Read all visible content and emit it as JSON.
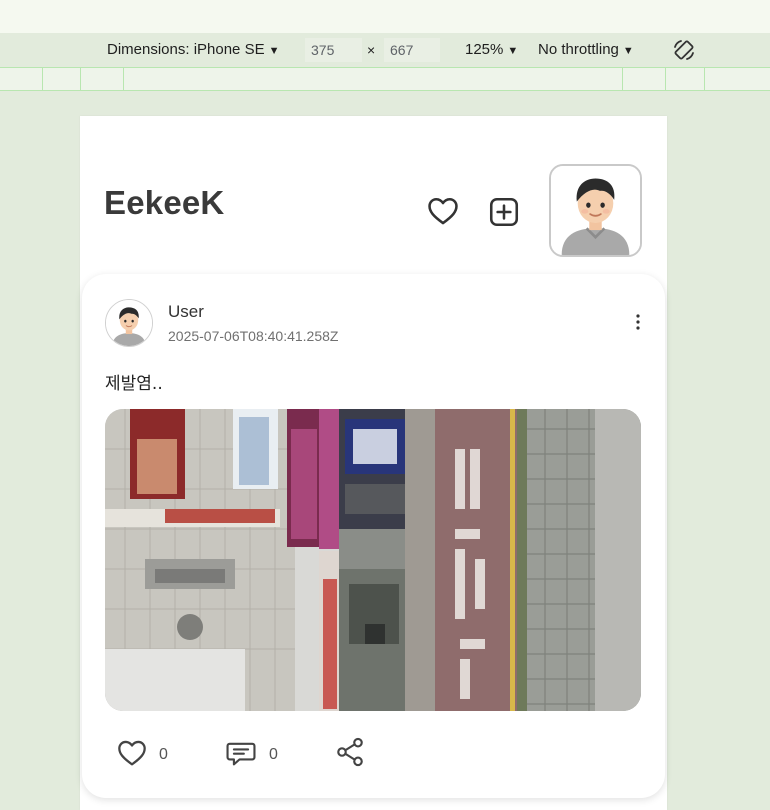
{
  "devtools": {
    "dimensions_label": "Dimensions: iPhone SE",
    "width_value": "375",
    "times_sign": "×",
    "height_value": "667",
    "zoom": "125%",
    "throttling": "No throttling",
    "icons": {
      "caret": "caret-down-icon",
      "rotate": "rotate-device-icon"
    }
  },
  "app": {
    "title": "EekeeK",
    "header_icons": [
      "heart-icon",
      "add-square-icon",
      "profile-avatar"
    ]
  },
  "post": {
    "username": "User",
    "timestamp": "2025-07-06T08:40:41.258Z",
    "text": "제발염..",
    "likes": "0",
    "comments": "0",
    "icons": [
      "more-vertical-icon",
      "heart-icon",
      "comment-icon",
      "share-icon"
    ]
  },
  "colors": {
    "page_bg": "#e2ebdc",
    "topbar_bg": "#f5f9f0",
    "ruler_line": "#b8e6b0",
    "card_bg": "#ffffff",
    "title_text": "#3a3a3a"
  }
}
